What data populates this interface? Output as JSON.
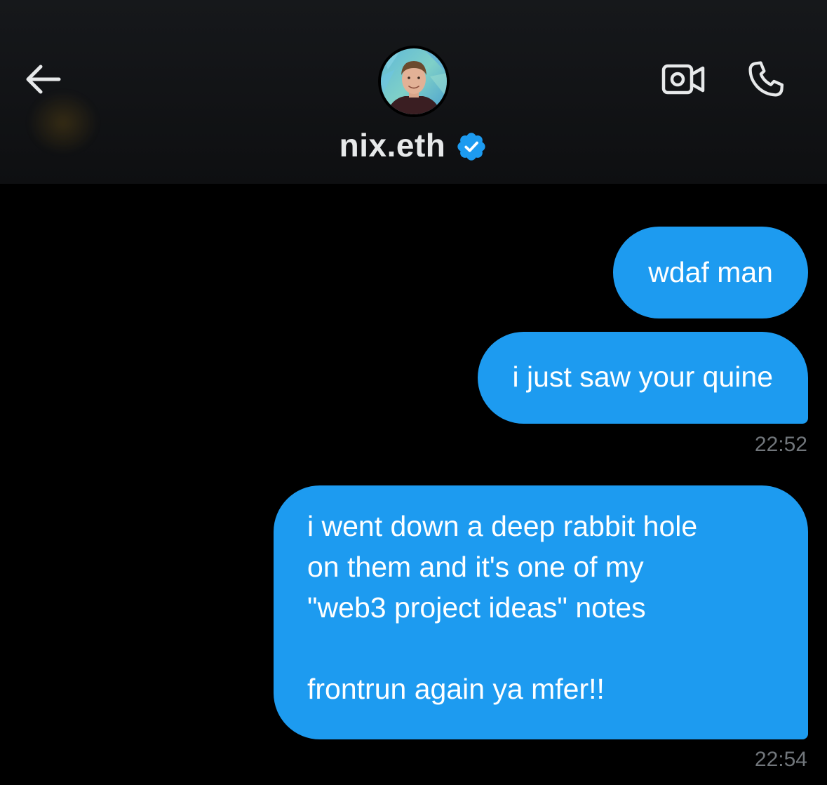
{
  "header": {
    "contact_name": "nix.eth",
    "verified": true,
    "icons": {
      "back": "arrow-left-icon",
      "video": "video-camera-icon",
      "phone": "phone-icon",
      "verified": "verified-badge-icon"
    }
  },
  "colors": {
    "bubble": "#1d9bf0",
    "verified": "#1d9bf0",
    "timestamp": "#71767b",
    "background": "#000000"
  },
  "messages": [
    {
      "text": "wdaf man",
      "sender": "me"
    },
    {
      "text": "i just saw your quine",
      "sender": "me",
      "timestamp": "22:52"
    },
    {
      "text": "i went down a deep rabbit hole\non them and it's one of my\n\"web3 project ideas\" notes\n\nfrontrun again ya mfer!!",
      "sender": "me",
      "timestamp": "22:54"
    }
  ]
}
